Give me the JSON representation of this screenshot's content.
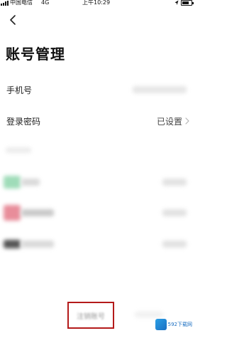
{
  "status_bar": {
    "carrier": "中国电信",
    "network": "4G",
    "time": "上午10:29"
  },
  "page": {
    "title": "账号管理"
  },
  "rows": {
    "phone_label": "手机号",
    "password_label": "登录密码",
    "password_value": "已设置"
  },
  "bindings": [
    {
      "color": "#9fdcb9"
    },
    {
      "color": "#e88d9a"
    },
    {
      "color": "#555555"
    }
  ],
  "footer": {
    "delete_label": "注销账号"
  },
  "watermark": {
    "text": "592下载网"
  },
  "icons": {
    "back": "chevron-left-icon",
    "chevron": "chevron-right-icon"
  }
}
